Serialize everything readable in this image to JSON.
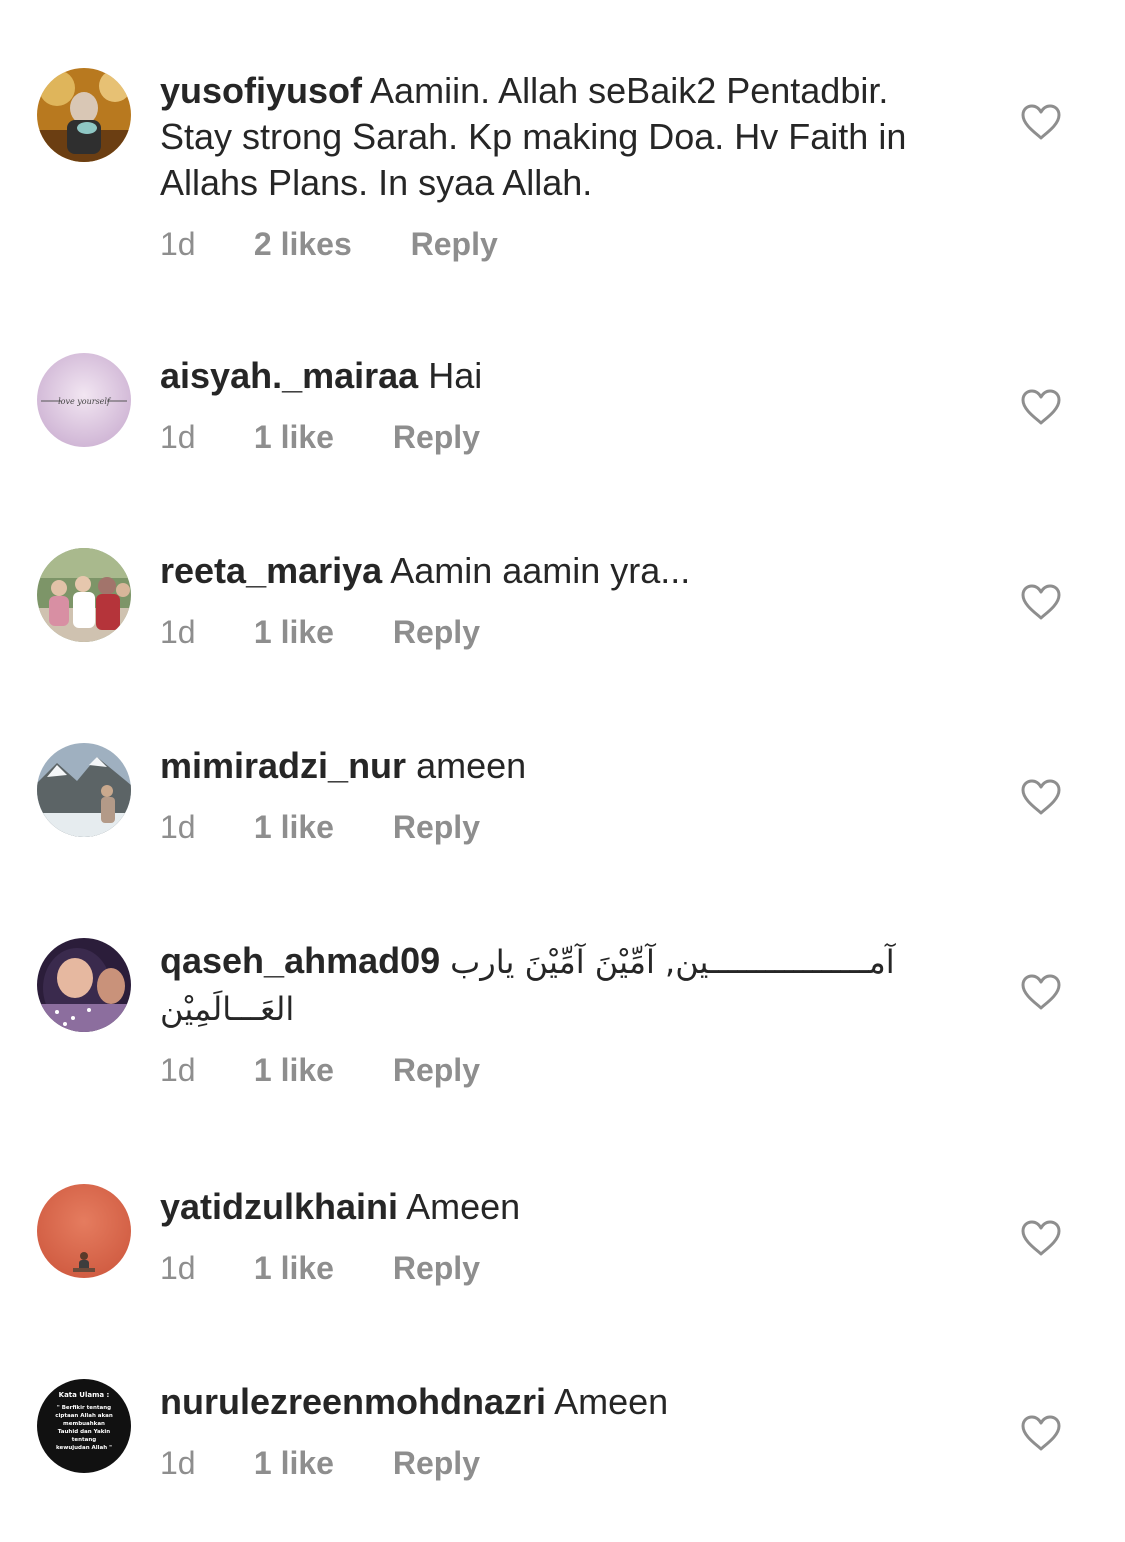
{
  "comments": [
    {
      "username": "yusofiyusof",
      "text": "Aamiin. Allah seBaik2 Pentadbir. Stay strong Sarah. Kp making Doa. Hv Faith in Allahs Plans. In syaa Allah.",
      "time": "1d",
      "likes": "2 likes",
      "reply": "Reply",
      "avatar_colors": [
        "#c08a2a",
        "#e9c46a",
        "#7a4a1a"
      ]
    },
    {
      "username": "aisyah._mairaa",
      "text": "Hai",
      "time": "1d",
      "likes": "1 like",
      "reply": "Reply",
      "avatar_text": "love yourself",
      "avatar_colors": [
        "#e8d6e8",
        "#cdb4d2"
      ]
    },
    {
      "username": "reeta_mariya",
      "text": "Aamin aamin yra...",
      "time": "1d",
      "likes": "1 like",
      "reply": "Reply",
      "avatar_colors": [
        "#6f8a5a",
        "#c97b8d",
        "#8f5a3c"
      ]
    },
    {
      "username": "mimiradzi_nur",
      "text": "ameen",
      "time": "1d",
      "likes": "1 like",
      "reply": "Reply",
      "avatar_colors": [
        "#9aa6b4",
        "#4f5a5c",
        "#e9eef2"
      ]
    },
    {
      "username": "qaseh_ahmad09",
      "text": "آمـــــــــــــــــين, آمِّيْنَ آمِّيْنَ يارب العَـــالَمِيْن",
      "time": "1d",
      "likes": "1 like",
      "reply": "Reply",
      "avatar_colors": [
        "#2b1d3a",
        "#b7a0c8",
        "#e6b8a0"
      ]
    },
    {
      "username": "yatidzulkhaini",
      "text": "Ameen",
      "time": "1d",
      "likes": "1 like",
      "reply": "Reply",
      "avatar_colors": [
        "#d9654a",
        "#e07d5c"
      ]
    },
    {
      "username": "nurulezreenmohdnazri",
      "text": "Ameen",
      "time": "1d",
      "likes": "1 like",
      "reply": "Reply",
      "avatar_colors": [
        "#111111"
      ],
      "avatar_lines": [
        "Kata Ulama :",
        "\" Berfikir tentang",
        "ciptaan Allah akan",
        "membuahkan",
        "Tauhid dan Yakin",
        "tentang",
        "kewujudan Allah \""
      ]
    }
  ],
  "icons": {
    "like": "heart-outline-icon"
  }
}
